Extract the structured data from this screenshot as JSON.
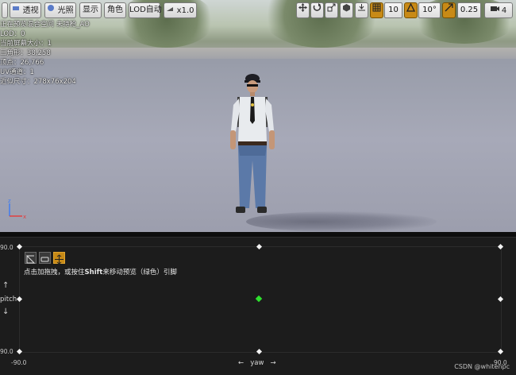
{
  "toolbar": {
    "perspective_label": "透视",
    "lighting_label": "光照",
    "show_label": "显示",
    "character_label": "角色",
    "lod_label": "LOD自动",
    "playback_label": "x1.0",
    "grid_snap_value": "10",
    "rotation_snap_value": "10°",
    "scale_snap_value": "0.25",
    "camera_speed_value": "4",
    "accent_color": "#c88a16"
  },
  "stats": {
    "line1": "正在预览混合空间 未持枪_AO",
    "line2": "LOD：0",
    "line3": "当前屏幕大小：1",
    "line4": "三角形：38,258",
    "line5": "顶点：26,766",
    "line6": "UV通道：1",
    "line7": "近似尺寸：278x76x204"
  },
  "blend_space": {
    "y_max": "90.0",
    "y_min": "90.0",
    "x_min": "-90.0",
    "x_max": "90.0",
    "hint": "点击加拖拽，或按住Shift来移动预览（绿色）引脚",
    "hint_bold": "Shift",
    "y_axis_label": "pitch",
    "x_axis_label": "yaw",
    "up_arrow": "↑",
    "down_arrow": "↓",
    "left_arrow": "←",
    "right_arrow": "→",
    "preview_pin_color": "#2ee02e"
  },
  "watermark": "CSDN @whitenpc"
}
